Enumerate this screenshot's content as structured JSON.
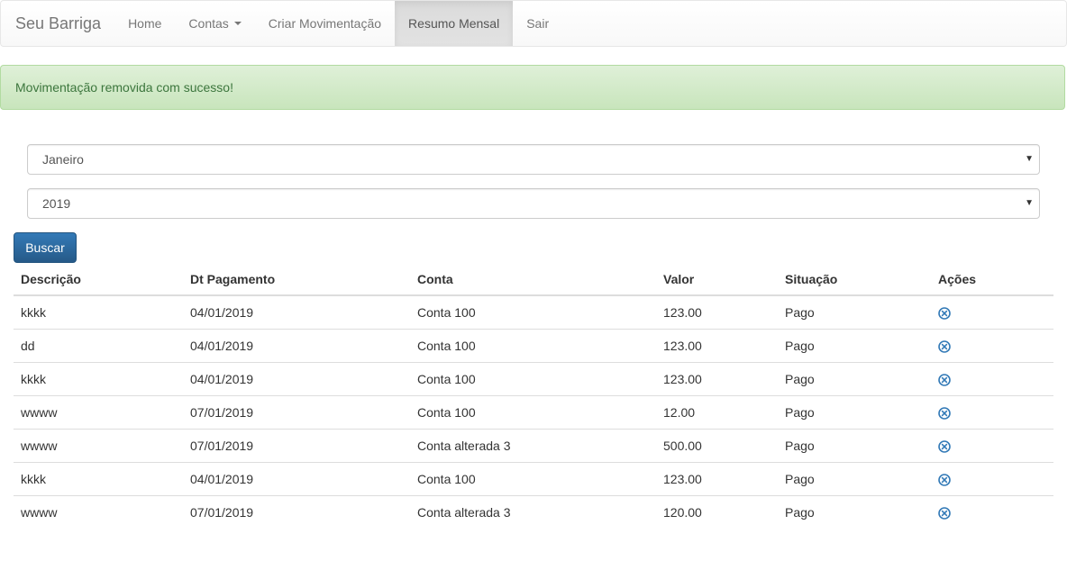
{
  "navbar": {
    "brand": "Seu Barriga",
    "items": [
      {
        "label": "Home"
      },
      {
        "label": "Contas"
      },
      {
        "label": "Criar Movimentação"
      },
      {
        "label": "Resumo Mensal"
      },
      {
        "label": "Sair"
      }
    ]
  },
  "alert": {
    "message": "Movimentação removida com sucesso!"
  },
  "filters": {
    "month": "Janeiro",
    "year": "2019",
    "search_label": "Buscar"
  },
  "table": {
    "headers": [
      "Descrição",
      "Dt Pagamento",
      "Conta",
      "Valor",
      "Situação",
      "Ações"
    ],
    "rows": [
      [
        "kkkk",
        "04/01/2019",
        "Conta 100",
        "123.00",
        "Pago"
      ],
      [
        "dd",
        "04/01/2019",
        "Conta 100",
        "123.00",
        "Pago"
      ],
      [
        "kkkk",
        "04/01/2019",
        "Conta 100",
        "123.00",
        "Pago"
      ],
      [
        "wwww",
        "07/01/2019",
        "Conta 100",
        "12.00",
        "Pago"
      ],
      [
        "wwww",
        "07/01/2019",
        "Conta alterada 3",
        "500.00",
        "Pago"
      ],
      [
        "kkkk",
        "04/01/2019",
        "Conta 100",
        "123.00",
        "Pago"
      ],
      [
        "wwww",
        "07/01/2019",
        "Conta alterada 3",
        "120.00",
        "Pago"
      ]
    ],
    "action_icon": "remove-circle-icon"
  },
  "colors": {
    "primary": "#337ab7",
    "success_bg": "#dff0d8",
    "success_text": "#3c763d"
  }
}
